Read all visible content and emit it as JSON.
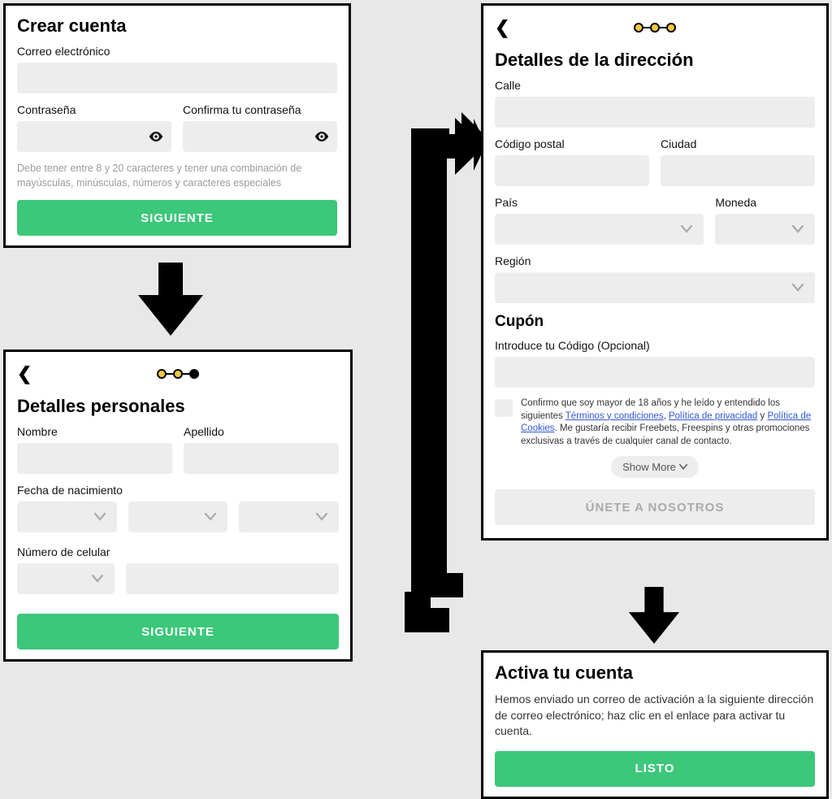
{
  "panel1": {
    "title": "Crear cuenta",
    "email_label": "Correo electrónico",
    "password_label": "Contraseña",
    "confirm_label": "Confirma tu contraseña",
    "hint": "Debe tener entre 8 y 20 caracteres y tener una combinación de mayúsculas, minúsculas, números y caracteres especiales",
    "next": "SIGUIENTE"
  },
  "panel2": {
    "title": "Detalles personales",
    "name_label": "Nombre",
    "surname_label": "Apellido",
    "dob_label": "Fecha de nacimiento",
    "phone_label": "Número de celular",
    "next": "SIGUIENTE"
  },
  "panel3": {
    "title": "Detalles de la dirección",
    "street_label": "Calle",
    "postal_label": "Código postal",
    "city_label": "Ciudad",
    "country_label": "País",
    "currency_label": "Moneda",
    "region_label": "Región",
    "coupon_title": "Cupón",
    "coupon_label": "Introduce tu Código (Opcional)",
    "consent_prefix": "Confirmo que soy mayor de 18 años y he leído y entendido los siguientes ",
    "link_terms": "Términos y condiciones",
    "link_privacy": "Política de privacidad",
    "link_cookies": "Política de Cookies",
    "consent_suffix": ". Me gustaría recibir Freebets, Freespins y otras promociones exclusivas a través de cualquier canal de contacto.",
    "sep1": ", ",
    "sep2": " y ",
    "show_more": "Show More",
    "join": "ÚNETE A NOSOTROS"
  },
  "panel4": {
    "title": "Activa tu cuenta",
    "desc": "Hemos enviado un correo de activación a la siguiente dirección de correo electrónico; haz clic en el enlace para activar tu cuenta.",
    "done": "LISTO"
  }
}
